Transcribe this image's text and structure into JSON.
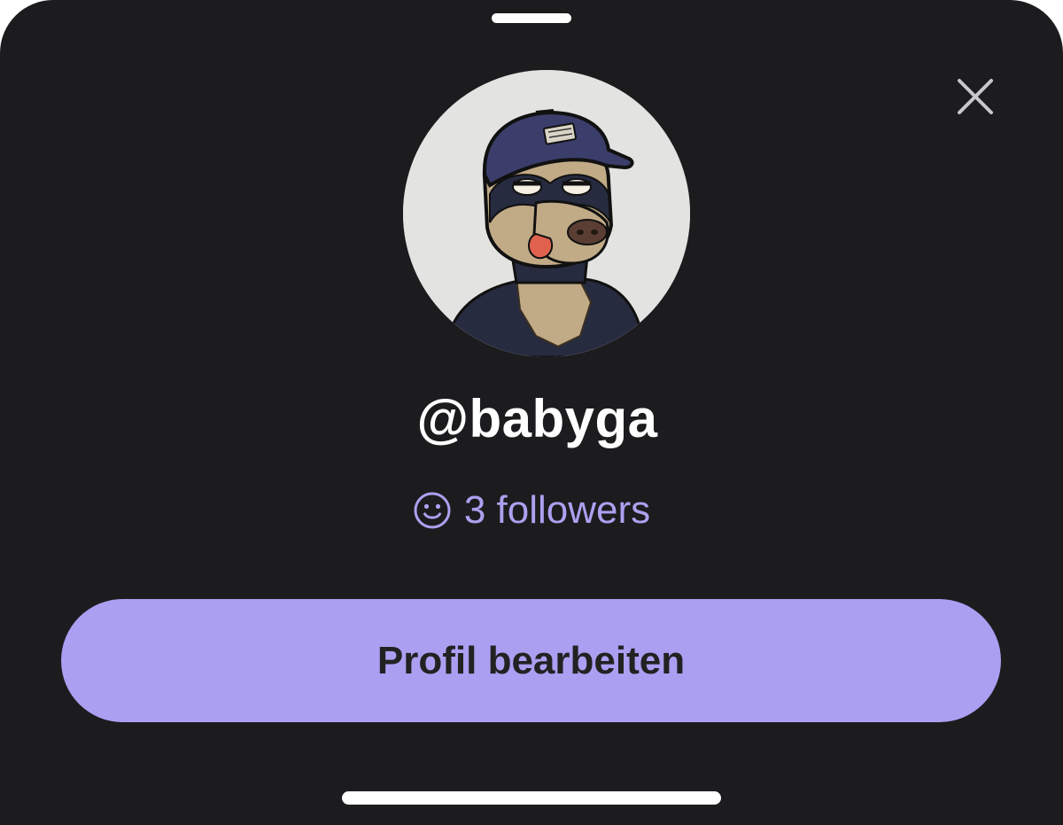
{
  "sheet": {
    "background": "#1c1c1e",
    "close_icon": "close-icon"
  },
  "profile": {
    "avatar_icon": "ape-avatar-illustration",
    "username": "@babyga",
    "followers_icon": "smiley-icon",
    "followers_text": "3 followers",
    "accent_color": "#aea0f0"
  },
  "actions": {
    "edit_profile_label": "Profil bearbeiten",
    "edit_profile_color": "#ab9ff2"
  }
}
